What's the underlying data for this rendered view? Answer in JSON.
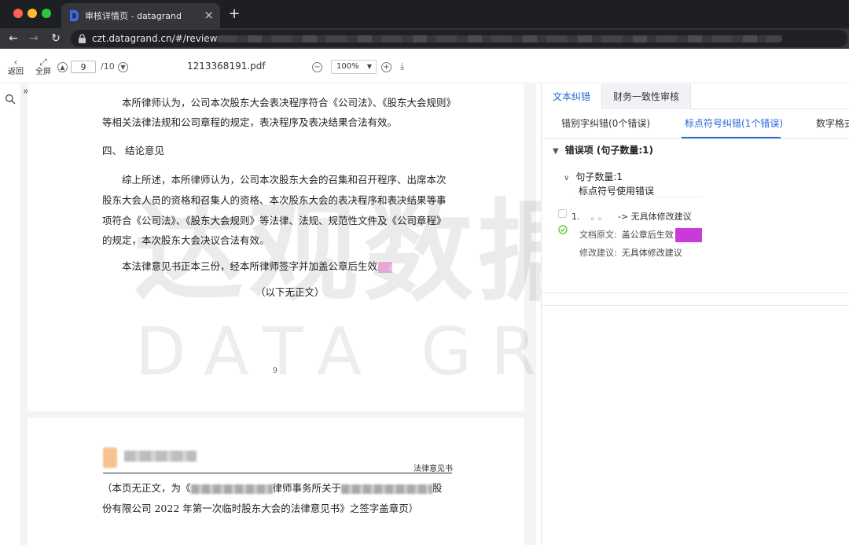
{
  "browser": {
    "tab_title": "审核详情页 - datagrand",
    "tab_close": "×",
    "new_tab": "+",
    "url": "czt.datagrand.cn/#/review"
  },
  "toolbar": {
    "back_label": "返回",
    "fullscreen_label": "全屏",
    "current_page": "9",
    "total_pages": "/10",
    "file_name": "1213368191.pdf",
    "zoom": "100%"
  },
  "document": {
    "page1": {
      "lines": [
        "本所律师认为，公司本次股东大会表决程序符合《公司法》、《股东大会规则》",
        "等相关法律法规和公司章程的规定，表决程序及表决结果合法有效。",
        "四、    结论意见",
        "综上所述，本所律师认为，公司本次股东大会的召集和召开程序、出席本次",
        "股东大会人员的资格和召集人的资格、本次股东大会的表决程序和表决结果等事",
        "项符合《公司法》、《股东大会规则》等法律、法规、规范性文件及《公司章程》",
        "的规定，本次股东大会决议合法有效。",
        "本法律意见书正本三份，经本所律师签字并加盖公章后生效",
        "（以下无正文）"
      ],
      "page_number": "9"
    },
    "page2": {
      "header_right": "法律意见书",
      "line1_start": "（本页无正文，为《",
      "line1_mid": "律师事务所关于",
      "line1_end": "股",
      "line2": "份有限公司 2022 年第一次临时股东大会的法律意见书》之签字盖章页）"
    },
    "watermark_cn": "达观数据",
    "watermark_en": "DATA GRAND"
  },
  "panel": {
    "main_tabs": [
      "文本纠错",
      "财务一致性审核"
    ],
    "sub_tabs": [
      "错别字纠错(0个错误)",
      "标点符号纠错(1个错误)",
      "数字格式"
    ],
    "section_title": "错误项 (句子数量:1)",
    "group_title": "句子数量:1",
    "group_subtitle": "标点符号使用错误",
    "error": {
      "index": "1.",
      "dots": "。。",
      "suggestion_arrow": "-> 无具体修改建议",
      "original_label": "文档原文:",
      "original_text": "盖公章后生效",
      "suggest_label": "修改建议:",
      "suggest_text": "无具体修改建议"
    }
  },
  "colors": {
    "accent": "#2468d8",
    "highlight": "#f5b8e6",
    "error_chip": "#c93ad9",
    "ok_green": "#52c41a"
  }
}
